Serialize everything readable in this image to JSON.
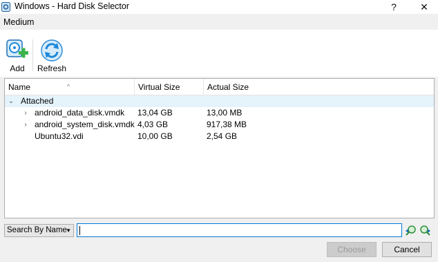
{
  "window": {
    "title": "Windows - Hard Disk Selector",
    "help_glyph": "?",
    "close_glyph": "✕"
  },
  "menu": {
    "items": [
      "Medium"
    ]
  },
  "toolbar": {
    "add_label": "Add",
    "refresh_label": "Refresh"
  },
  "table": {
    "sort_indicator": "^",
    "columns": [
      "Name",
      "Virtual Size",
      "Actual Size"
    ],
    "group": {
      "label": "Attached",
      "expanded": true
    },
    "rows": [
      {
        "name": "android_data_disk.vmdk",
        "virtual": "13,04 GB",
        "actual": "13,00 MB",
        "expandable": true
      },
      {
        "name": "android_system_disk.vmdk",
        "virtual": "4,03 GB",
        "actual": "917,38 MB",
        "expandable": true
      },
      {
        "name": "Ubuntu32.vdi",
        "virtual": "10,00 GB",
        "actual": "2,54 GB",
        "expandable": false
      }
    ]
  },
  "search": {
    "mode": "Search By Name",
    "value": ""
  },
  "buttons": {
    "choose": "Choose",
    "cancel": "Cancel"
  },
  "colors": {
    "group_highlight": "#e5f3fb",
    "focus_border": "#0078d7",
    "icon_blue": "#1e88d8",
    "icon_green": "#3cb44a"
  }
}
